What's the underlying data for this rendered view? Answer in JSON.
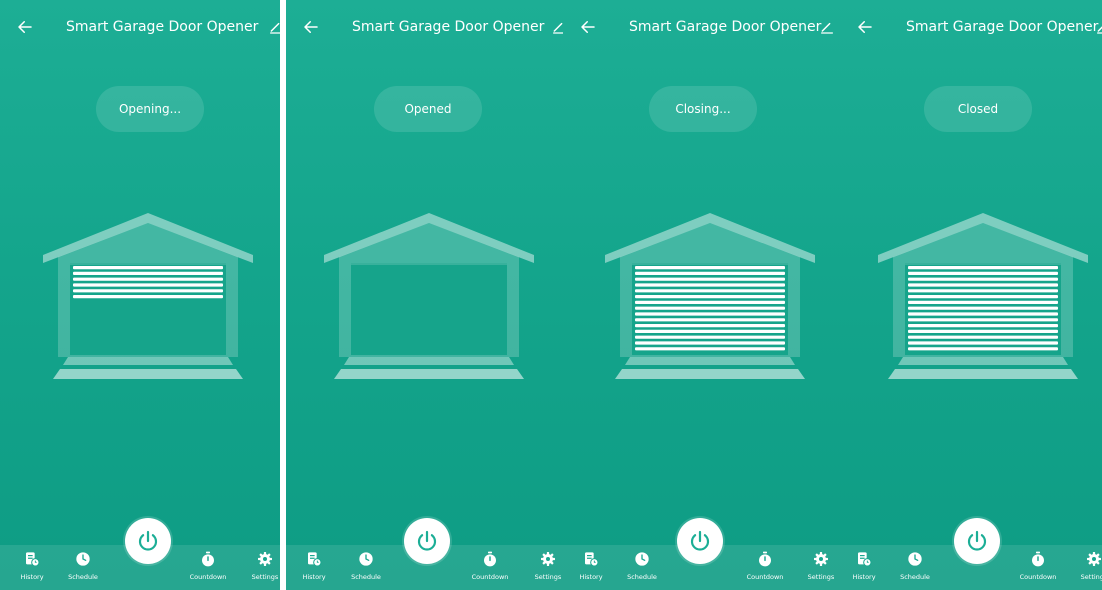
{
  "screens": [
    {
      "title": "Smart Garage Door Opener",
      "status": "Opening...",
      "door_closed_fraction": 0.38,
      "nav": [
        "History",
        "Schedule",
        "Countdown",
        "Settings"
      ]
    },
    {
      "title": "Smart Garage Door Opener",
      "status": "Opened",
      "door_closed_fraction": 0,
      "nav": [
        "History",
        "Schedule",
        "Countdown",
        "Settings"
      ]
    },
    {
      "title": "Smart Garage Door Opener",
      "status": "Closing...",
      "door_closed_fraction": 1,
      "nav": [
        "History",
        "Schedule",
        "Countdown",
        "Settings"
      ]
    },
    {
      "title": "Smart Garage Door Opener",
      "status": "Closed",
      "door_closed_fraction": 1,
      "nav": [
        "History",
        "Schedule",
        "Countdown",
        "Settings"
      ]
    }
  ],
  "icons": {
    "back": "arrow-left-icon",
    "edit": "pencil-icon",
    "history": "history-list-icon",
    "schedule": "clock-icon",
    "power": "power-icon",
    "countdown": "stopwatch-icon",
    "settings": "gear-icon"
  },
  "colors": {
    "background_top": "#1dae95",
    "background_bottom": "#0e9c84",
    "accent": "#1cae96",
    "foreground": "#ffffff"
  }
}
